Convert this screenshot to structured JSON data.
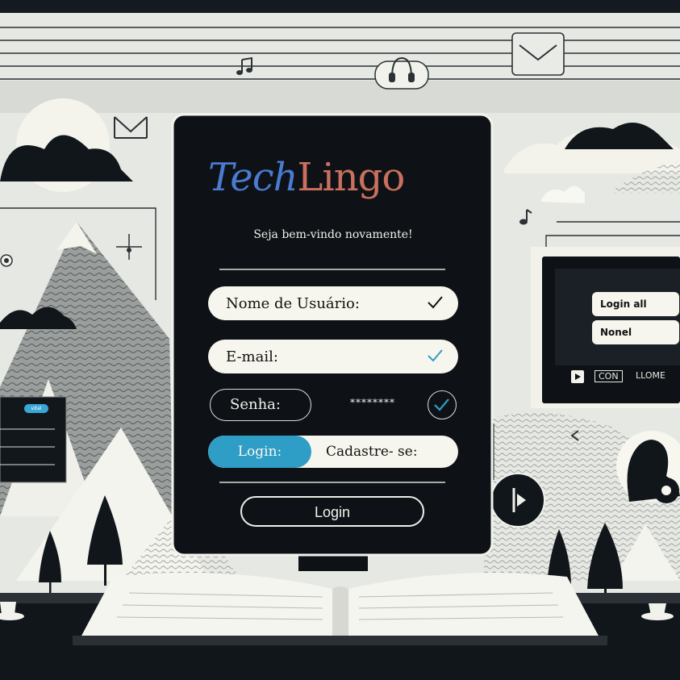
{
  "app": {
    "brand_part1": "Tech",
    "brand_part2": "Lingo",
    "welcome": "Seja bem-vindo novamente!"
  },
  "form": {
    "username_label": "Nome de Usuário:",
    "email_label": "E-mail:",
    "password_label": "Senha:",
    "password_value": "********",
    "toggle_login": "Login:",
    "toggle_signup": "Cadastre- se:",
    "login_button": "Login"
  },
  "side_panel": {
    "card1": "Login all",
    "card2": "Nonel",
    "footer_con": "CON",
    "footer_llome": "LLOME"
  },
  "left_panel": {
    "tag": "vital"
  },
  "icons": [
    "music-note-icon",
    "headphones-icon",
    "mail-icon",
    "check-icon",
    "play-icon",
    "chevron-left-icon",
    "avatar-gear-icon",
    "coffee-cup-icon",
    "open-book-icon"
  ],
  "colors": {
    "brand_blue": "#4a7bd0",
    "brand_coral": "#c9705f",
    "accent_cyan": "#2f9ec6",
    "panel_black": "#0e1216"
  }
}
